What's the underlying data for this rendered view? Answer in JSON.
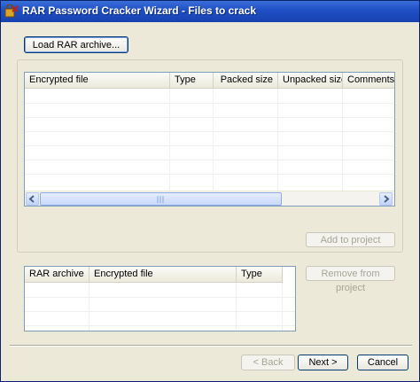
{
  "window": {
    "title": "RAR Password Cracker Wizard - Files to crack"
  },
  "toolbar": {
    "load_label": "Load RAR archive..."
  },
  "archive_list": {
    "columns": [
      "Encrypted file",
      "Type",
      "Packed size",
      "Unpacked size",
      "Comments"
    ],
    "rows": []
  },
  "actions": {
    "add_label": "Add to project",
    "remove_label": "Remove from project"
  },
  "project_list": {
    "columns": [
      "RAR archive",
      "Encrypted file",
      "Type"
    ],
    "rows": []
  },
  "footer": {
    "back_label": "< Back",
    "next_label": "Next >",
    "cancel_label": "Cancel"
  },
  "icons": {
    "title": "wizard-app-icon",
    "scroll_left": "scroll-left-arrow-icon",
    "scroll_right": "scroll-right-arrow-icon",
    "thumb_grip": "scroll-grip-icon"
  },
  "colors": {
    "title_bar": "#1f4fc4",
    "window_bg": "#ece9d8",
    "list_border": "#7f9db9"
  }
}
